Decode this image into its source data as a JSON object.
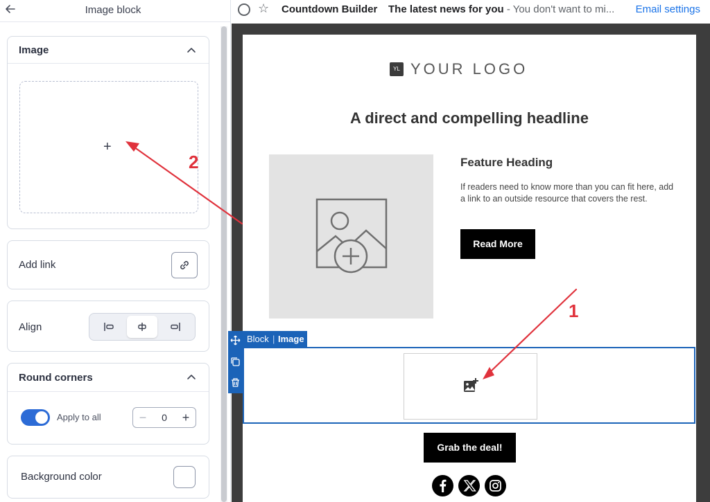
{
  "left_panel": {
    "title": "Image block",
    "image_section": {
      "title": "Image",
      "dropzone_glyph": "+"
    },
    "add_link": {
      "label": "Add link"
    },
    "align": {
      "label": "Align",
      "options": [
        "left",
        "center",
        "right"
      ],
      "selected": "center"
    },
    "round_corners": {
      "title": "Round corners",
      "apply_all_label": "Apply to all",
      "apply_all_on": true,
      "value": "0",
      "minus": "−",
      "plus": "+"
    },
    "background_color": {
      "label": "Background color",
      "value": "#ffffff"
    }
  },
  "mail_header": {
    "sender": "Countdown Builder",
    "subject": "The latest news for you",
    "snippet": " - You don't want to mi...",
    "settings_link": "Email settings"
  },
  "email": {
    "logo_badge": "YL",
    "logo_text": "YOUR LOGO",
    "headline": "A direct and compelling headline",
    "feature_heading": "Feature Heading",
    "feature_body": "If readers need to know more than you can fit here, add a link to an outside resource that covers the rest.",
    "read_more": "Read More",
    "block_tab": {
      "block": "Block",
      "separator": "|",
      "type": "Image"
    },
    "cta": "Grab the deal!",
    "social": [
      "facebook-icon",
      "x-icon",
      "instagram-icon"
    ]
  },
  "annotations": {
    "one": "1",
    "two": "2",
    "color": "#e0323c"
  },
  "colors": {
    "accent": "#1b63b8",
    "toggle": "#2c6bd6",
    "link": "#1a73e8"
  }
}
